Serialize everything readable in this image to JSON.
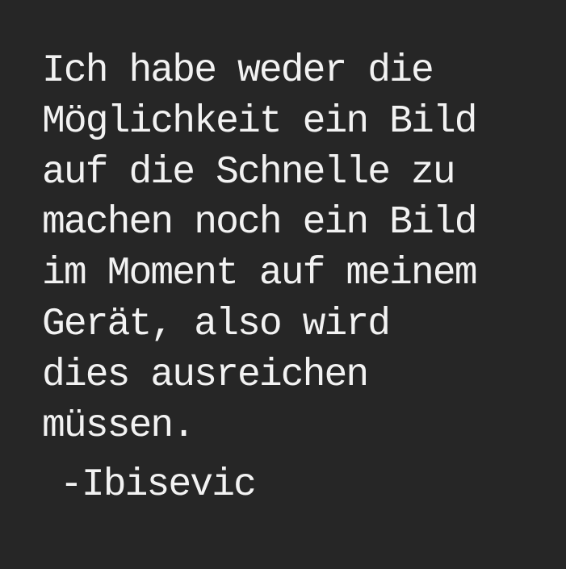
{
  "quote": {
    "lines": [
      "Ich habe weder die",
      "Möglichkeit ein Bild",
      "auf die Schnelle zu",
      "machen noch ein Bild",
      "im Moment auf meinem",
      "Gerät, also wird",
      "dies ausreichen",
      "müssen."
    ],
    "attribution": "-Ibisevic"
  },
  "colors": {
    "background": "#262626",
    "text": "#f2f2f2"
  }
}
